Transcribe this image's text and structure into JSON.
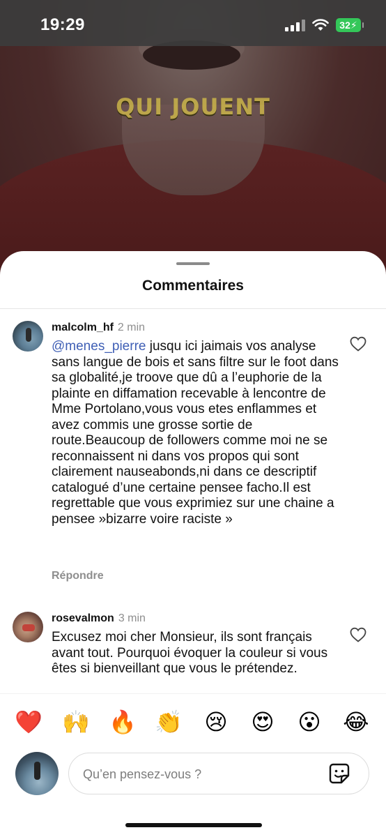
{
  "status_bar": {
    "time": "19:29",
    "battery": "32"
  },
  "video": {
    "caption": "QUI JOUENT"
  },
  "sheet": {
    "title": "Commentaires"
  },
  "comments": [
    {
      "username": "malcolm_hf",
      "time": "2 min",
      "mention": "@menes_pierre",
      "text": " jusqu ici jaimais vos analyse sans langue de bois et sans filtre sur le foot dans sa globalité,je troove que dû a l’euphorie de la plainte en diffamation recevable à lencontre de Mme Portolano,vous vous etes enflammes et avez commis une grosse sortie de route.Beaucoup de followers comme moi ne se reconnaissent ni dans vos propos qui sont clairement nauseabonds,ni dans ce descriptif catalogué d’une certaine pensee facho.Il est regrettable que vous exprimiez sur une chaine a pensee »bizarre voire raciste »",
      "reply_label": "Répondre"
    },
    {
      "username": "rosevalmon",
      "time": "3 min",
      "text": "Excusez moi cher Monsieur, ils sont français avant tout. Pourquoi évoquer la couleur si vous êtes si bienveillant que vous le prétendez."
    }
  ],
  "reactions": [
    "❤️",
    "🙌",
    "🔥",
    "👏",
    "😢",
    "😍",
    "😮",
    "😂"
  ],
  "composer": {
    "placeholder": "Qu’en pensez-vous ?"
  }
}
